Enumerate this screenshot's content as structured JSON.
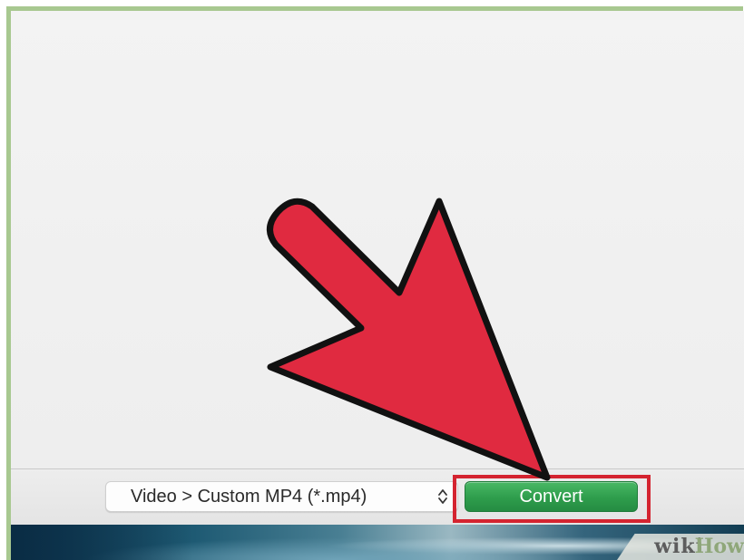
{
  "toolbar": {
    "format_select": {
      "value": "Video > Custom MP4 (*.mp4)",
      "icon": "up-down-chevron-icon"
    },
    "convert_button": {
      "label": "Convert",
      "color": "#2e9d4c",
      "highlight_color": "#d42430"
    }
  },
  "annotation": {
    "arrow_icon": "red-pointer-arrow",
    "arrow_color": "#e02a40"
  },
  "watermark": {
    "part1": "wiki",
    "part2": "How"
  },
  "colors": {
    "frame": "#a8c890",
    "window_bg": "#f2f2f2"
  }
}
